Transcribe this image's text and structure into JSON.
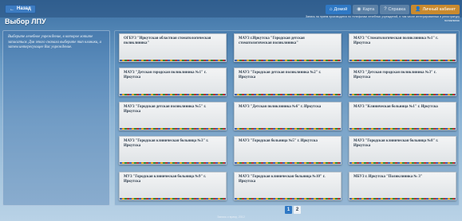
{
  "header": {
    "back_label": "Назад",
    "back_icon": "←",
    "page_title": "Выбор ЛПУ",
    "actions": [
      {
        "label": "Домой",
        "icon": "⌂",
        "style": "home"
      },
      {
        "label": "Карта",
        "icon": "◉",
        "style": "map"
      },
      {
        "label": "Справка",
        "icon": "?",
        "style": "help"
      },
      {
        "label": "Личный кабинет",
        "icon": "👤",
        "style": "cabinet"
      }
    ],
    "notice": "Запись на прием производится по телефонам лечебных учреждений, в том числе интегрированных в регистратуру поликлиник"
  },
  "info": {
    "text": "Выберите лечебное учреждение, в которое хотите записаться. Для этого сначала выберите тип клиники, а затем интересующее Вас учреждение."
  },
  "facilities": [
    "ОГБУЗ \"Иркутская областная стоматологическая поликлиника\"",
    "МАУЗ г.Иркутска \"Городская детская стоматологическая поликлиника\"",
    "МАУЗ \"Стоматологическая поликлиника №1\" г. Иркутска",
    "МАУЗ \"Детская городская поликлиника №1\" г. Иркутска",
    "МАУЗ \"Городская детская поликлиника №2\" г. Иркутска",
    "МАУЗ \"Детская городская поликлиника №3\" г. Иркутска",
    "МАУЗ \"Городская детская поликлиника №5\" г. Иркутска",
    "МАУЗ \"Детская поликлиника №6\" г. Иркутска",
    "МАУЗ \"Клиническая больница №1\" г. Иркутска",
    "МАУЗ \"Городская клиническая больница №3\" г. Иркутска",
    "МАУЗ \"Городская больница №5\" г. Иркутска",
    "МАУЗ \"Городская клиническая больница №8\" г. Иркутска",
    "МУЗ \"Городская клиническая больница №9\" г. Иркутска",
    "МАУЗ \"Городская клиническая больница №10\" г. Иркутска",
    "МБУЗ г. Иркутска \"Поликлиника № 3\""
  ],
  "pagination": {
    "pages": [
      "1",
      "2"
    ],
    "active": "1"
  },
  "footer": "Запись к врачу, 2012"
}
